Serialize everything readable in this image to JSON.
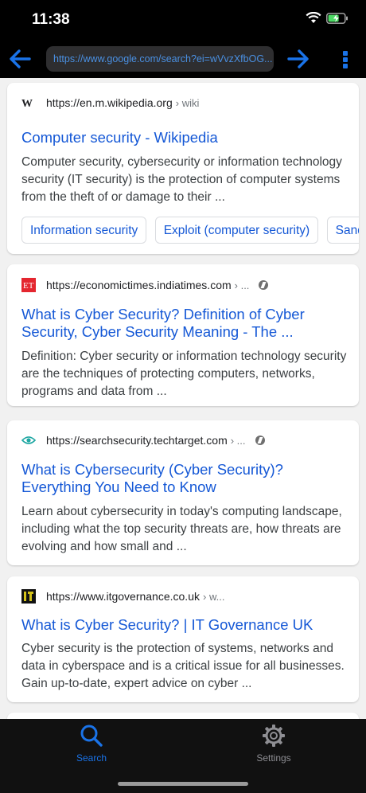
{
  "status": {
    "time": "11:38"
  },
  "browser": {
    "url": "https://www.google.com/search?ei=wVvzXfbOG..."
  },
  "results": [
    {
      "source_url": "https://en.m.wikipedia.org",
      "breadcrumb": "› wiki",
      "favicon": "wikipedia-w",
      "title": "Computer security - Wikipedia",
      "snippet": "Computer security, cybersecurity or information technology security (IT security) is the protection of computer systems from the theft of or damage to their ...",
      "chips": [
        "Information security",
        "Exploit (computer security)",
        "Sandbox"
      ]
    },
    {
      "source_url": "https://economictimes.indiatimes.com",
      "breadcrumb": "› ...",
      "favicon": "et-logo",
      "title": "What is Cyber Security? Definition of Cyber Security, Cyber Security Meaning - The ...",
      "snippet": "Definition: Cyber security or information technology security are the techniques of protecting computers, networks, programs and data from ..."
    },
    {
      "source_url": "https://searchsecurity.techtarget.com",
      "breadcrumb": "› ...",
      "favicon": "eye-logo",
      "title": "What is Cybersecurity (Cyber Security)? Everything You Need to Know",
      "snippet": "Learn about cybersecurity in today's computing landscape, including what the top security threats are, how threats are evolving and how small and ..."
    },
    {
      "source_url": "https://www.itgovernance.co.uk",
      "breadcrumb": "› w...",
      "favicon": "itgov-logo",
      "title": "What is Cyber Security? | IT Governance UK",
      "snippet": "Cyber security is the protection of systems, networks and data in cyberspace and is a critical issue for all businesses. Gain up-to-date, expert advice on cyber ..."
    }
  ],
  "tabs": {
    "search": "Search",
    "settings": "Settings"
  },
  "colors": {
    "accent": "#1a73e8",
    "link": "#1558d6",
    "toolbar": "#000000"
  }
}
